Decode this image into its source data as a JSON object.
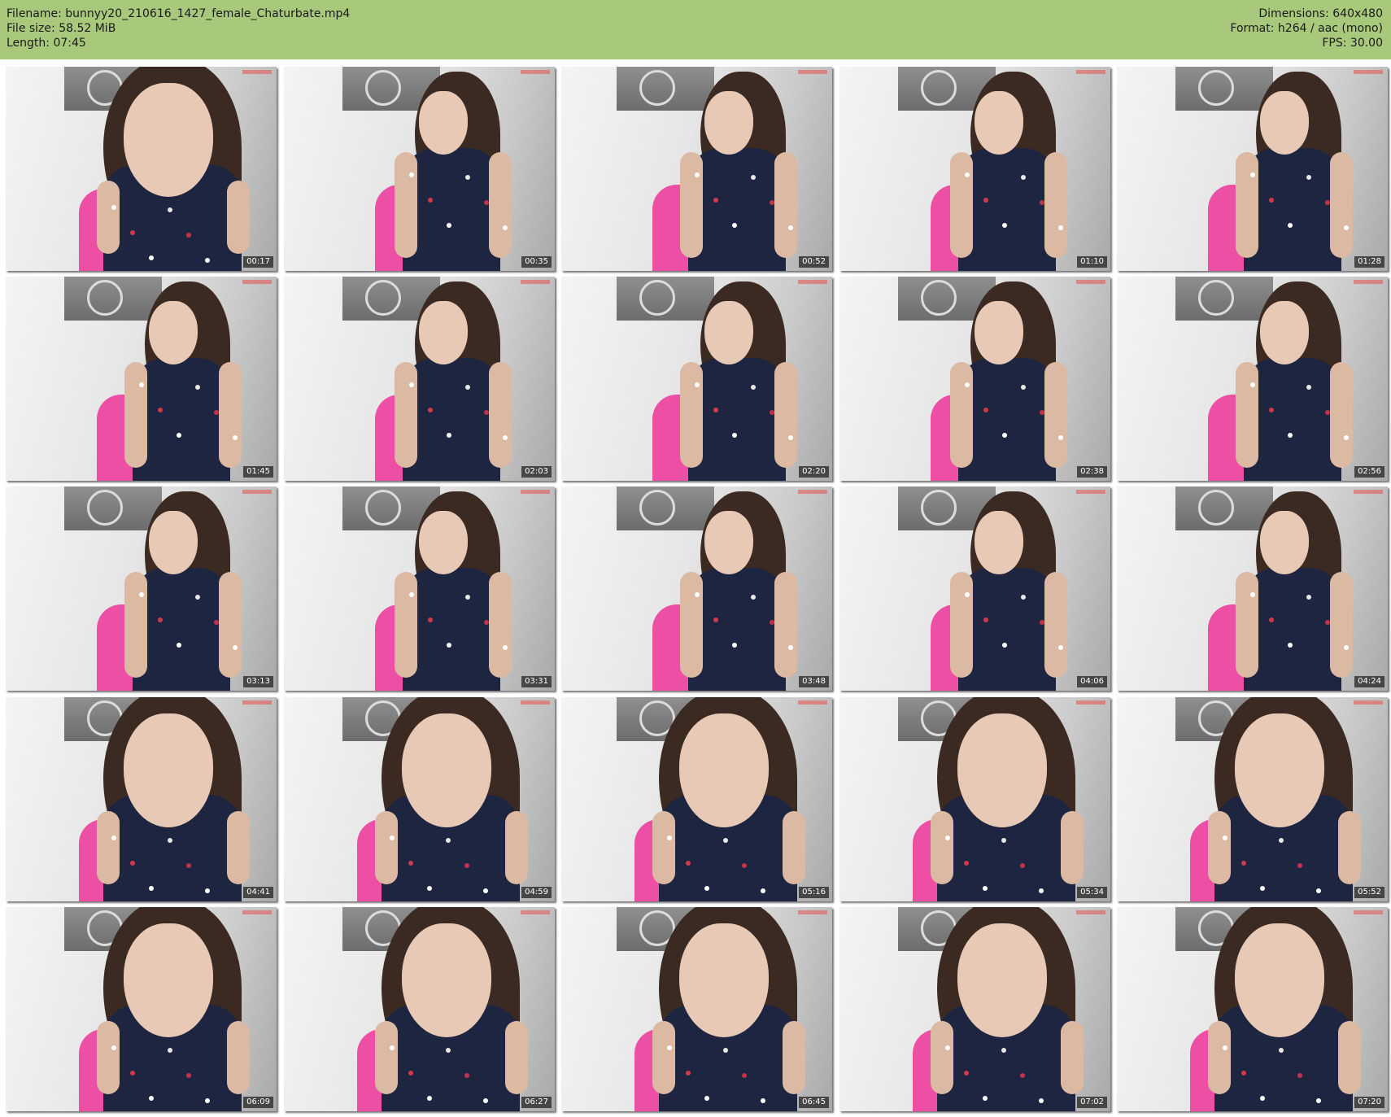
{
  "header": {
    "filename_line": "Filename: bunnyy20_210616_1427_female_Chaturbate.mp4",
    "filesize_line": "File size: 58.52 MiB",
    "length_line": "Length: 07:45",
    "dimensions_line": "Dimensions: 640x480",
    "format_line": "Format: h264 / aac (mono)",
    "fps_line": "FPS: 30.00"
  },
  "colors": {
    "header_bg": "#a8c97c",
    "chair_pink": "#ec4fa4",
    "dress_navy": "#1e2540"
  },
  "thumbnails": [
    {
      "time": "00:17"
    },
    {
      "time": "00:35"
    },
    {
      "time": "00:52"
    },
    {
      "time": "01:10"
    },
    {
      "time": "01:28"
    },
    {
      "time": "01:45"
    },
    {
      "time": "02:03"
    },
    {
      "time": "02:20"
    },
    {
      "time": "02:38"
    },
    {
      "time": "02:56"
    },
    {
      "time": "03:13"
    },
    {
      "time": "03:31"
    },
    {
      "time": "03:48"
    },
    {
      "time": "04:06"
    },
    {
      "time": "04:24"
    },
    {
      "time": "04:41"
    },
    {
      "time": "04:59"
    },
    {
      "time": "05:16"
    },
    {
      "time": "05:34"
    },
    {
      "time": "05:52"
    },
    {
      "time": "06:09"
    },
    {
      "time": "06:27"
    },
    {
      "time": "06:45"
    },
    {
      "time": "07:02"
    },
    {
      "time": "07:20"
    }
  ]
}
